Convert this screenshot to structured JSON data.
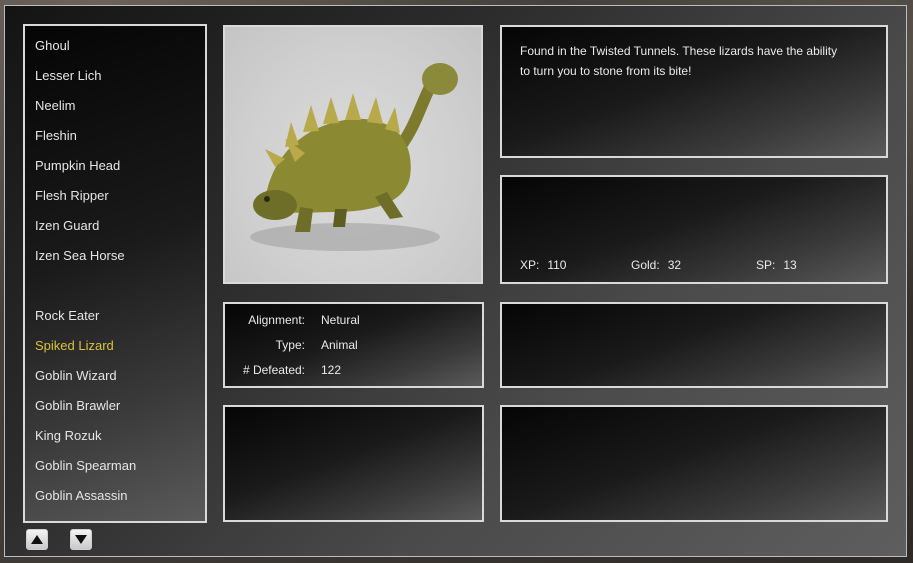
{
  "creatures": [
    "Ghoul",
    "Lesser Lich",
    "Neelim",
    "Fleshin",
    "Pumpkin Head",
    "Flesh Ripper",
    "Izen Guard",
    "Izen Sea Horse",
    "",
    "Rock Eater",
    "Spiked Lizard",
    "Goblin Wizard",
    "Goblin Brawler",
    "King Rozuk",
    "Goblin Spearman",
    "Goblin Assassin"
  ],
  "selected": "Spiked Lizard",
  "description": "Found in the Twisted Tunnels. These lizards have the ability to turn you to stone from its bite!",
  "info": {
    "alignment_label": "Alignment:",
    "alignment": "Netural",
    "type_label": "Type:",
    "type": "Animal",
    "defeated_label": "# Defeated:",
    "defeated": "122"
  },
  "rewards": {
    "xp_label": "XP:",
    "xp": "110",
    "gold_label": "Gold:",
    "gold": "32",
    "sp_label": "SP:",
    "sp": "13"
  },
  "colors": {
    "selected_text": "#d9c33a",
    "normal_text": "#e6e6e6",
    "border": "#d9d9d9"
  },
  "icons": {
    "scroll_up": "up-arrow-icon",
    "scroll_down": "down-arrow-icon"
  }
}
